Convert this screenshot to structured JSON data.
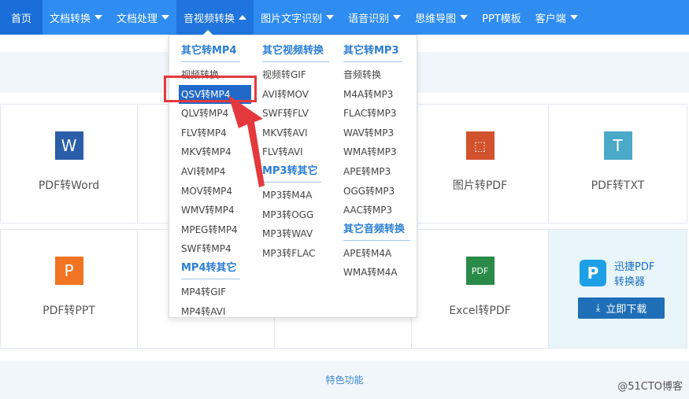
{
  "nav": {
    "items": [
      {
        "label": "首页",
        "caret": "none"
      },
      {
        "label": "文档转换",
        "caret": "down"
      },
      {
        "label": "文档处理",
        "caret": "down"
      },
      {
        "label": "音视频转换",
        "caret": "up"
      },
      {
        "label": "图片文字识别",
        "caret": "down"
      },
      {
        "label": "语音识别",
        "caret": "down"
      },
      {
        "label": "思维导图",
        "caret": "down"
      },
      {
        "label": "PPT模板",
        "caret": "none"
      },
      {
        "label": "客户端",
        "caret": "down"
      }
    ]
  },
  "dropdown": {
    "col1": {
      "sections": [
        {
          "title": "其它转MP4",
          "items": [
            "视频转换",
            "QSV转MP4",
            "QLV转MP4",
            "FLV转MP4",
            "MKV转MP4",
            "AVI转MP4",
            "MOV转MP4",
            "WMV转MP4",
            "MPEG转MP4",
            "SWF转MP4"
          ]
        },
        {
          "title": "MP4转其它",
          "items": [
            "MP4转GIF",
            "MP4转AVI"
          ]
        }
      ]
    },
    "col2": {
      "sections": [
        {
          "title": "其它视频转换",
          "items": [
            "视频转GIF",
            "AVI转MOV",
            "SWF转FLV",
            "MKV转AVI",
            "FLV转AVI"
          ]
        },
        {
          "title": "MP3转其它",
          "items": [
            "MP3转M4A",
            "MP3转OGG",
            "MP3转WAV",
            "MP3转FLAC"
          ]
        }
      ]
    },
    "col3": {
      "sections": [
        {
          "title": "其它转MP3",
          "items": [
            "音频转换",
            "M4A转MP3",
            "FLAC转MP3",
            "WAV转MP3",
            "WMA转MP3",
            "APE转MP3",
            "OGG转MP3",
            "AAC转MP3"
          ]
        },
        {
          "title": "其它音频转换",
          "items": [
            "APE转M4A",
            "WMA转M4A"
          ]
        }
      ]
    },
    "selected_item": "QSV转MP4"
  },
  "tools": {
    "row1": [
      {
        "label": "PDF转Word",
        "icon": "W"
      },
      {
        "label": "",
        "icon": ""
      },
      {
        "label": "",
        "icon": ""
      },
      {
        "label": "图片转PDF",
        "icon": "⬚"
      },
      {
        "label": "PDF转TXT",
        "icon": "T"
      }
    ],
    "row2": [
      {
        "label": "PDF转PPT",
        "icon": "P"
      },
      {
        "label": "",
        "icon": ""
      },
      {
        "label": "",
        "icon": ""
      },
      {
        "label": "Excel转PDF",
        "icon": "PDF"
      }
    ]
  },
  "promo": {
    "name_line1": "迅捷PDF",
    "name_line2": "转换器",
    "logo": "P",
    "download_label": "立即下载"
  },
  "features_label": "特色功能",
  "watermark": "@51CTO博客",
  "colors": {
    "nav": "#2f8cf0",
    "accent": "#2b7ed3",
    "highlight": "#e4393c",
    "selected": "#2169c9"
  }
}
